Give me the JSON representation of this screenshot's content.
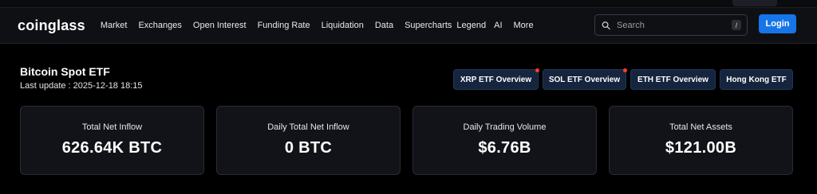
{
  "header": {
    "logo": "coinglass",
    "nav": [
      "Market",
      "Exchanges",
      "Open Interest",
      "Funding Rate",
      "Liquidation",
      "Data",
      "Supercharts",
      "Legend",
      "AI",
      "More"
    ],
    "search_placeholder": "Search",
    "search_shortcut": "/",
    "login_label": "Login"
  },
  "page": {
    "title": "Bitcoin Spot ETF",
    "last_update": "Last update : 2025-12-18 18:15"
  },
  "etf_buttons": [
    {
      "label": "XRP ETF Overview",
      "new": true
    },
    {
      "label": "SOL ETF Overview",
      "new": true
    },
    {
      "label": "ETH ETF Overview",
      "new": false
    },
    {
      "label": "Hong Kong ETF",
      "new": false
    }
  ],
  "stats": [
    {
      "label": "Total Net Inflow",
      "value": "626.64K BTC"
    },
    {
      "label": "Daily Total Net Inflow",
      "value": "0 BTC"
    },
    {
      "label": "Daily Trading Volume",
      "value": "$6.76B"
    },
    {
      "label": "Total Net Assets",
      "value": "$121.00B"
    }
  ],
  "colors": {
    "accent": "#1675e8",
    "new_dot": "#ff3b30"
  }
}
